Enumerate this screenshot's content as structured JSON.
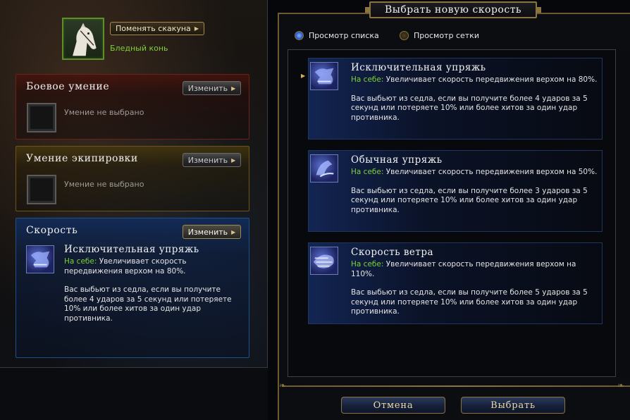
{
  "mount": {
    "change_button": "Поменять скакуна",
    "name": "Бледный конь"
  },
  "slots": {
    "combat": {
      "title": "Боевое умение",
      "change_button": "Изменить",
      "empty_label": "Умение не выбрано"
    },
    "equipment": {
      "title": "Умение экипировки",
      "change_button": "Изменить",
      "empty_label": "Умение не выбрано"
    },
    "speed": {
      "title": "Скорость",
      "change_button": "Изменить",
      "selected": {
        "name": "Исключительная упряжь",
        "on_self_label": "На себе:",
        "effect": "Увеличивает скорость передвижения верхом на 80%.",
        "dismount": "Вас выбьют из седла, если вы получите более 4 ударов за 5 секунд или потеряете 10% или более хитов за один удар противника."
      }
    }
  },
  "dialog": {
    "title": "Выбрать новую скорость",
    "view_list": "Просмотр списка",
    "view_grid": "Просмотр сетки",
    "items": [
      {
        "name": "Исключительная упряжь",
        "on_self_label": "На себе:",
        "effect": "Увеличивает скорость передвижения верхом на 80%.",
        "dismount": "Вас выбьют из седла, если вы получите более 4 ударов за 5 секунд или потеряете 10% или более хитов за один удар противника."
      },
      {
        "name": "Обычная упряжь",
        "on_self_label": "На себе:",
        "effect": "Увеличивает скорость передвижения верхом на 50%.",
        "dismount": "Вас выбьют из седла, если вы получите более 3 ударов за 5 секунд или потеряете 10% или более хитов за один удар противника."
      },
      {
        "name": "Скорость ветра",
        "on_self_label": "На себе:",
        "effect": "Увеличивает скорость передвижения верхом на 110%.",
        "dismount": "Вас выбьют из седла, если вы получите более 5 ударов за 5 секунд или потеряете 10% или более хитов за один удар противника."
      }
    ],
    "cancel_button": "Отмена",
    "select_button": "Выбрать"
  },
  "colors": {
    "on_self_green": "#7ed03a",
    "gold_border": "#8a7442",
    "speed_blue": "#1e4f8a"
  }
}
